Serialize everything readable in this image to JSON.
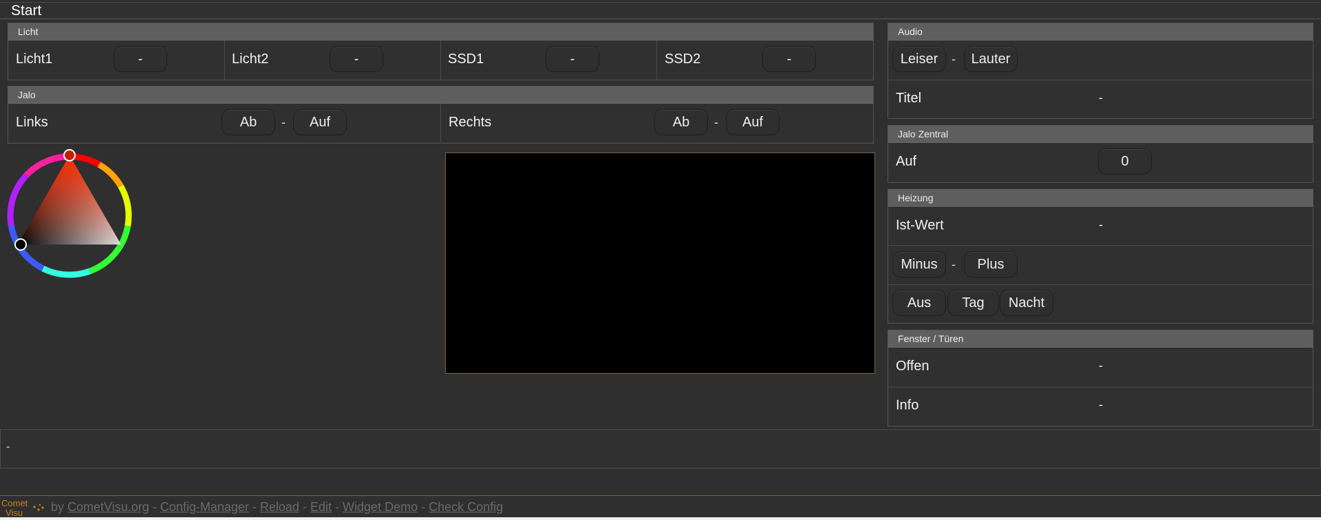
{
  "title": "Start",
  "licht": {
    "header": "Licht",
    "items": [
      {
        "label": "Licht1",
        "button": "-"
      },
      {
        "label": "Licht2",
        "button": "-"
      },
      {
        "label": "SSD1",
        "button": "-"
      },
      {
        "label": "SSD2",
        "button": "-"
      }
    ]
  },
  "jalo": {
    "header": "Jalo",
    "left": {
      "label": "Links",
      "down": "Ab",
      "sep": "-",
      "up": "Auf"
    },
    "right": {
      "label": "Rechts",
      "down": "Ab",
      "sep": "-",
      "up": "Auf"
    }
  },
  "audio": {
    "header": "Audio",
    "leiser": "Leiser",
    "sep": "-",
    "lauter": "Lauter",
    "titel_label": "Titel",
    "titel_value": "-"
  },
  "jalo_zentral": {
    "header": "Jalo Zentral",
    "label": "Auf",
    "value": "0"
  },
  "heizung": {
    "header": "Heizung",
    "ist_label": "Ist-Wert",
    "ist_value": "-",
    "minus": "Minus",
    "sep": "-",
    "plus": "Plus",
    "aus": "Aus",
    "tag": "Tag",
    "nacht": "Nacht"
  },
  "fenster": {
    "header": "Fenster / Türen",
    "offen_label": "Offen",
    "offen_value": "-",
    "info_label": "Info",
    "info_value": "-"
  },
  "status": {
    "text": "-"
  },
  "footer": {
    "by": "by",
    "links": [
      "CometVisu.org",
      "Config-Manager",
      "Reload",
      "Edit",
      "Widget Demo",
      "Check Config"
    ],
    "sep": "-",
    "logo_text_top": "Comet",
    "logo_text_bottom": "Visu"
  },
  "colors": {
    "background": "#2f2f2f",
    "header": "#5e5e5e",
    "accent": "#c8821e"
  }
}
